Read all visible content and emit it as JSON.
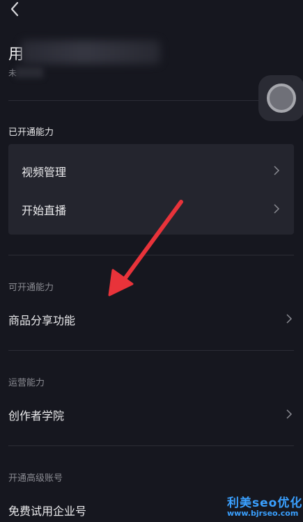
{
  "header": {
    "back_icon": "chevron-left-icon",
    "name_prefix": "用",
    "status_prefix": "未"
  },
  "sections": {
    "enabled": {
      "title": "已开通能力",
      "items": [
        {
          "label": "视频管理"
        },
        {
          "label": "开始直播"
        }
      ]
    },
    "available": {
      "title": "可开通能力",
      "items": [
        {
          "label": "商品分享功能"
        }
      ]
    },
    "operation": {
      "title": "运营能力",
      "items": [
        {
          "label": "创作者学院"
        }
      ]
    },
    "advanced": {
      "title": "开通高级账号",
      "items": [
        {
          "label": "免费试用企业号"
        }
      ]
    }
  },
  "watermark": {
    "line1": "利美seo优化",
    "line2": "www.bjrseo.com"
  },
  "colors": {
    "background": "#16171f",
    "card": "#24252e",
    "arrow": "#e8333a",
    "watermark": "#3aa0ff"
  }
}
